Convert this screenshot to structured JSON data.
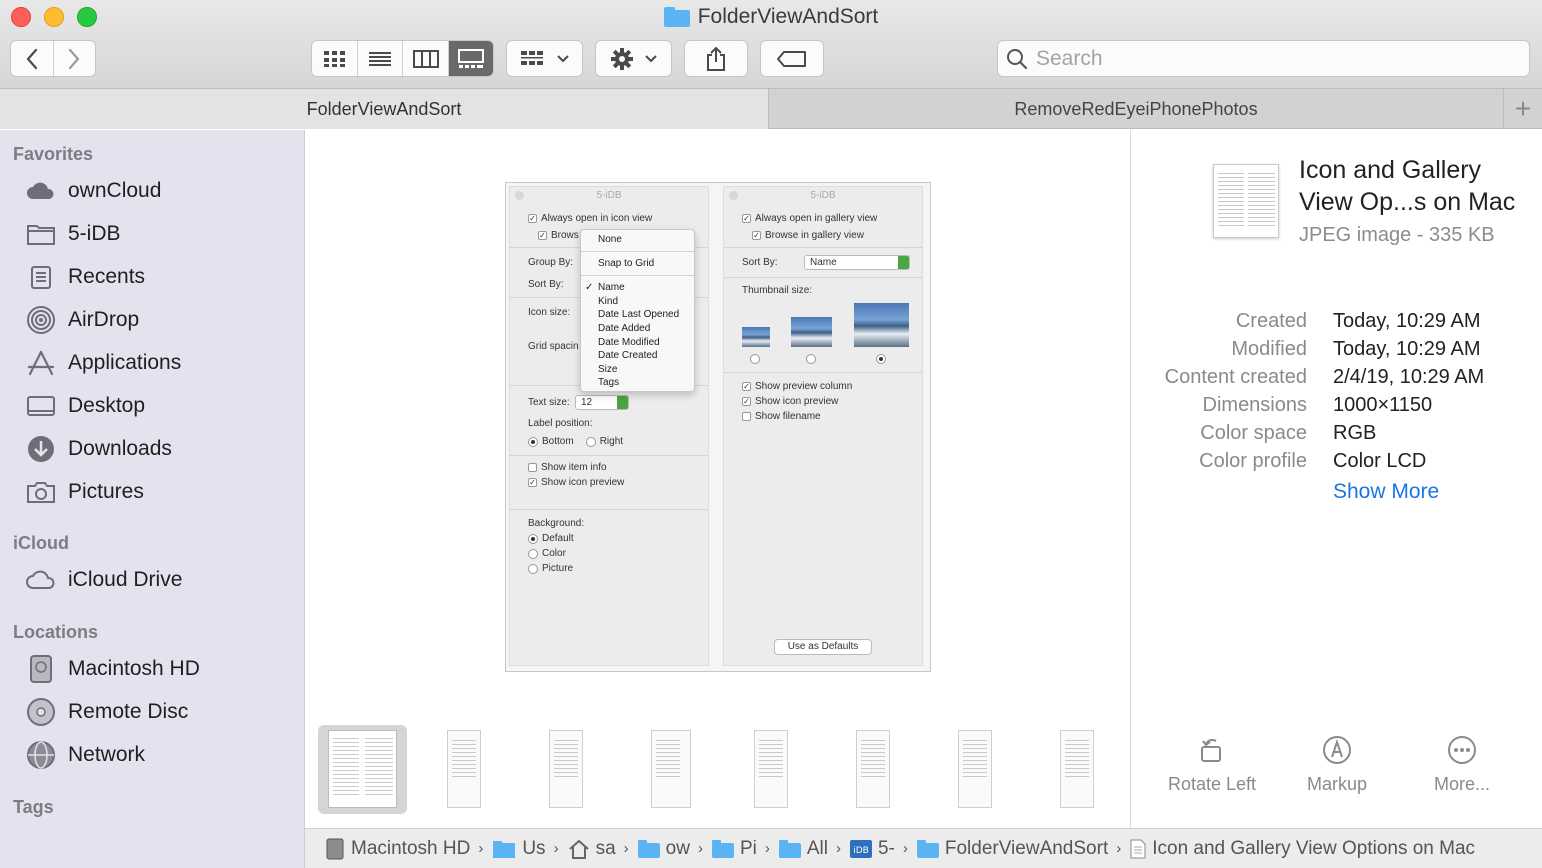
{
  "window": {
    "title": "FolderViewAndSort"
  },
  "toolbar": {
    "back_icon": "chevron-left-icon",
    "forward_icon": "chevron-right-icon",
    "view_modes": [
      "icon",
      "list",
      "column",
      "gallery"
    ],
    "active_view": "gallery",
    "search": {
      "placeholder": "Search",
      "value": ""
    }
  },
  "tabs": [
    {
      "label": "FolderViewAndSort",
      "active": true
    },
    {
      "label": "RemoveRedEyeiPhonePhotos",
      "active": false
    }
  ],
  "sidebar": {
    "favorites_heading": "Favorites",
    "favorites": [
      {
        "label": "ownCloud",
        "icon": "cloud-icon"
      },
      {
        "label": "5-iDB",
        "icon": "folder-icon"
      },
      {
        "label": "Recents",
        "icon": "recents-icon"
      },
      {
        "label": "AirDrop",
        "icon": "airdrop-icon"
      },
      {
        "label": "Applications",
        "icon": "applications-icon"
      },
      {
        "label": "Desktop",
        "icon": "desktop-icon"
      },
      {
        "label": "Downloads",
        "icon": "downloads-icon"
      },
      {
        "label": "Pictures",
        "icon": "camera-icon"
      }
    ],
    "icloud_heading": "iCloud",
    "icloud": [
      {
        "label": "iCloud Drive",
        "icon": "icloud-icon"
      }
    ],
    "locations_heading": "Locations",
    "locations": [
      {
        "label": "Macintosh HD",
        "icon": "hard-drive-icon"
      },
      {
        "label": "Remote Disc",
        "icon": "disc-icon"
      },
      {
        "label": "Network",
        "icon": "globe-icon"
      }
    ],
    "tags_heading": "Tags"
  },
  "preview": {
    "left_pane": {
      "title": "5-iDB",
      "always_open": "Always open in icon view",
      "browse": "Brows",
      "group_by": "Group By:",
      "sort_by": "Sort By:",
      "icon_size": "Icon size:",
      "grid_spacing": "Grid spacin",
      "text_size_label": "Text size:",
      "text_size_value": "12",
      "label_position": "Label position:",
      "bottom": "Bottom",
      "right": "Right",
      "show_item_info": "Show item info",
      "show_icon_preview": "Show icon preview",
      "background": "Background:",
      "bg_default": "Default",
      "bg_color": "Color",
      "bg_picture": "Picture"
    },
    "menu": {
      "items": [
        "None",
        "Snap to Grid",
        "Name",
        "Kind",
        "Date Last Opened",
        "Date Added",
        "Date Modified",
        "Date Created",
        "Size",
        "Tags"
      ],
      "checked": "Name"
    },
    "right_pane": {
      "title": "5-iDB",
      "always_open": "Always open in gallery view",
      "browse": "Browse in gallery view",
      "sort_by": "Sort By:",
      "sort_value": "Name",
      "thumbnail_size": "Thumbnail size:",
      "show_preview_column": "Show preview column",
      "show_icon_preview": "Show icon preview",
      "show_filename": "Show filename",
      "use_as_defaults": "Use as Defaults"
    }
  },
  "filmstrip": {
    "count": 8,
    "selected_index": 0
  },
  "info": {
    "name": "Icon and Gallery View Op...s on Mac",
    "type": "JPEG image - 335 KB",
    "metadata": [
      {
        "key": "Created",
        "value": "Today, 10:29 AM"
      },
      {
        "key": "Modified",
        "value": "Today, 10:29 AM"
      },
      {
        "key": "Content created",
        "value": "2/4/19, 10:29 AM"
      },
      {
        "key": "Dimensions",
        "value": "1000×1150"
      },
      {
        "key": "Color space",
        "value": "RGB"
      },
      {
        "key": "Color profile",
        "value": "Color LCD"
      }
    ],
    "show_more": "Show More",
    "actions": [
      {
        "label": "Rotate Left",
        "icon": "rotate-left-icon"
      },
      {
        "label": "Markup",
        "icon": "markup-icon"
      },
      {
        "label": "More...",
        "icon": "more-icon"
      }
    ]
  },
  "pathbar": [
    {
      "label": "Macintosh HD",
      "icon": "hard-drive-icon"
    },
    {
      "label": "Us",
      "icon": "folder-icon"
    },
    {
      "label": "sa",
      "icon": "home-icon"
    },
    {
      "label": "ow",
      "icon": "folder-icon"
    },
    {
      "label": "Pi",
      "icon": "folder-icon"
    },
    {
      "label": "All",
      "icon": "folder-icon"
    },
    {
      "label": "5-",
      "icon": "idb-icon"
    },
    {
      "label": "FolderViewAndSort",
      "icon": "folder-icon"
    },
    {
      "label": "Icon and Gallery View Options on Mac",
      "icon": "image-file-icon"
    }
  ],
  "colors": {
    "accent": "#1a74e8",
    "sidebar_bg": "#e4e2ee",
    "folder_blue": "#5ab3f2"
  }
}
